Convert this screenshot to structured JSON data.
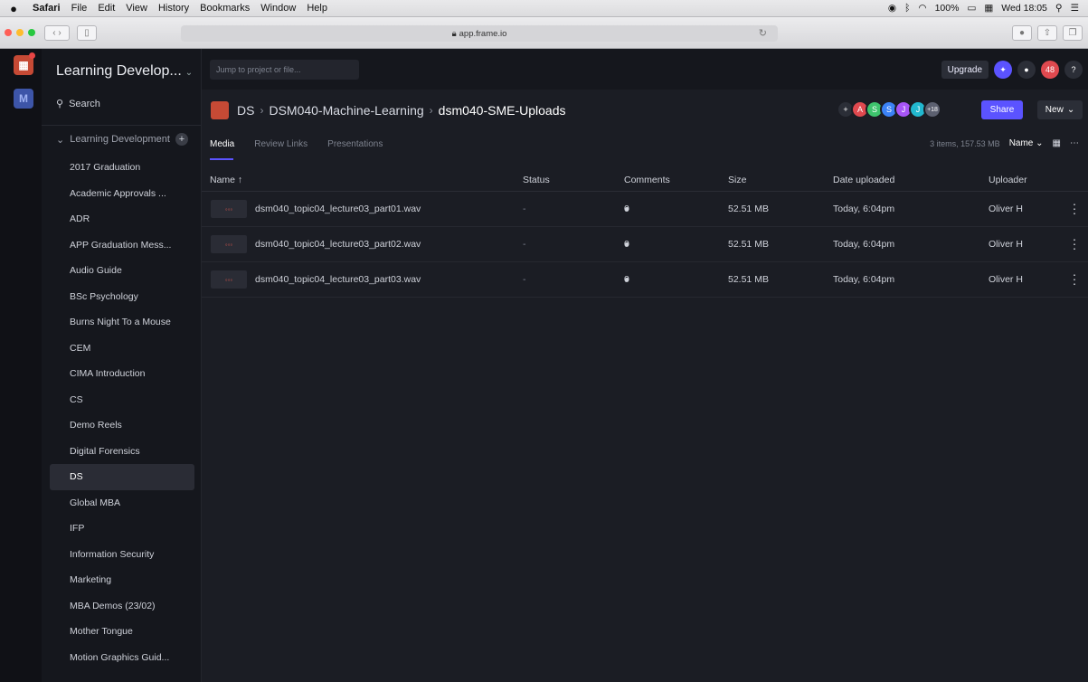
{
  "menubar": {
    "apple": "",
    "items": [
      "Safari",
      "File",
      "Edit",
      "View",
      "History",
      "Bookmarks",
      "Window",
      "Help"
    ],
    "battery": "100%",
    "clock": "Wed 18:05"
  },
  "browser": {
    "url": "app.frame.io"
  },
  "rail": {
    "workspace2": "M"
  },
  "sidebar": {
    "project": "Learning Develop...",
    "search_label": "Search",
    "team": "Learning Development",
    "items": [
      "2017 Graduation",
      "Academic Approvals ...",
      "ADR",
      "APP Graduation Mess...",
      "Audio Guide",
      "BSc Psychology",
      "Burns Night To a Mouse",
      "CEM",
      "CIMA Introduction",
      "CS",
      "Demo Reels",
      "Digital Forensics",
      "DS",
      "Global MBA",
      "IFP",
      "Information Security",
      "Marketing",
      "MBA Demos (23/02)",
      "Mother Tongue",
      "Motion Graphics Guid..."
    ],
    "active": "DS"
  },
  "topbar": {
    "jump_placeholder": "Jump to project or file...",
    "upgrade": "Upgrade",
    "notifications": "48",
    "help": "?"
  },
  "breadcrumb": {
    "root": "DS",
    "middle": "DSM040-Machine-Learning",
    "current": "dsm040-SME-Uploads"
  },
  "collaborators": {
    "initials": [
      "A",
      "S",
      "S",
      "J",
      "J"
    ],
    "more": "+18",
    "colors": [
      "#e0494f",
      "#3ec46d",
      "#3b82f6",
      "#a855f7",
      "#22b8cf"
    ]
  },
  "actions": {
    "share": "Share",
    "new": "New"
  },
  "tabs": [
    "Media",
    "Review Links",
    "Presentations"
  ],
  "view": {
    "count": "3 items, 157.53 MB",
    "sort": "Name"
  },
  "table": {
    "headers": {
      "name": "Name ↑",
      "status": "Status",
      "comments": "Comments",
      "size": "Size",
      "date": "Date uploaded",
      "uploader": "Uploader"
    },
    "rows": [
      {
        "name": "dsm040_topic04_lecture03_part01.wav",
        "status": "-",
        "comments": "0",
        "size": "52.51 MB",
        "date": "Today, 6:04pm",
        "uploader": "Oliver H"
      },
      {
        "name": "dsm040_topic04_lecture03_part02.wav",
        "status": "-",
        "comments": "0",
        "size": "52.51 MB",
        "date": "Today, 6:04pm",
        "uploader": "Oliver H"
      },
      {
        "name": "dsm040_topic04_lecture03_part03.wav",
        "status": "-",
        "comments": "0",
        "size": "52.51 MB",
        "date": "Today, 6:04pm",
        "uploader": "Oliver H"
      }
    ]
  },
  "colors": {
    "accent": "#5b53ff",
    "bg": "#1b1d24",
    "sidebar": "#15171d"
  }
}
